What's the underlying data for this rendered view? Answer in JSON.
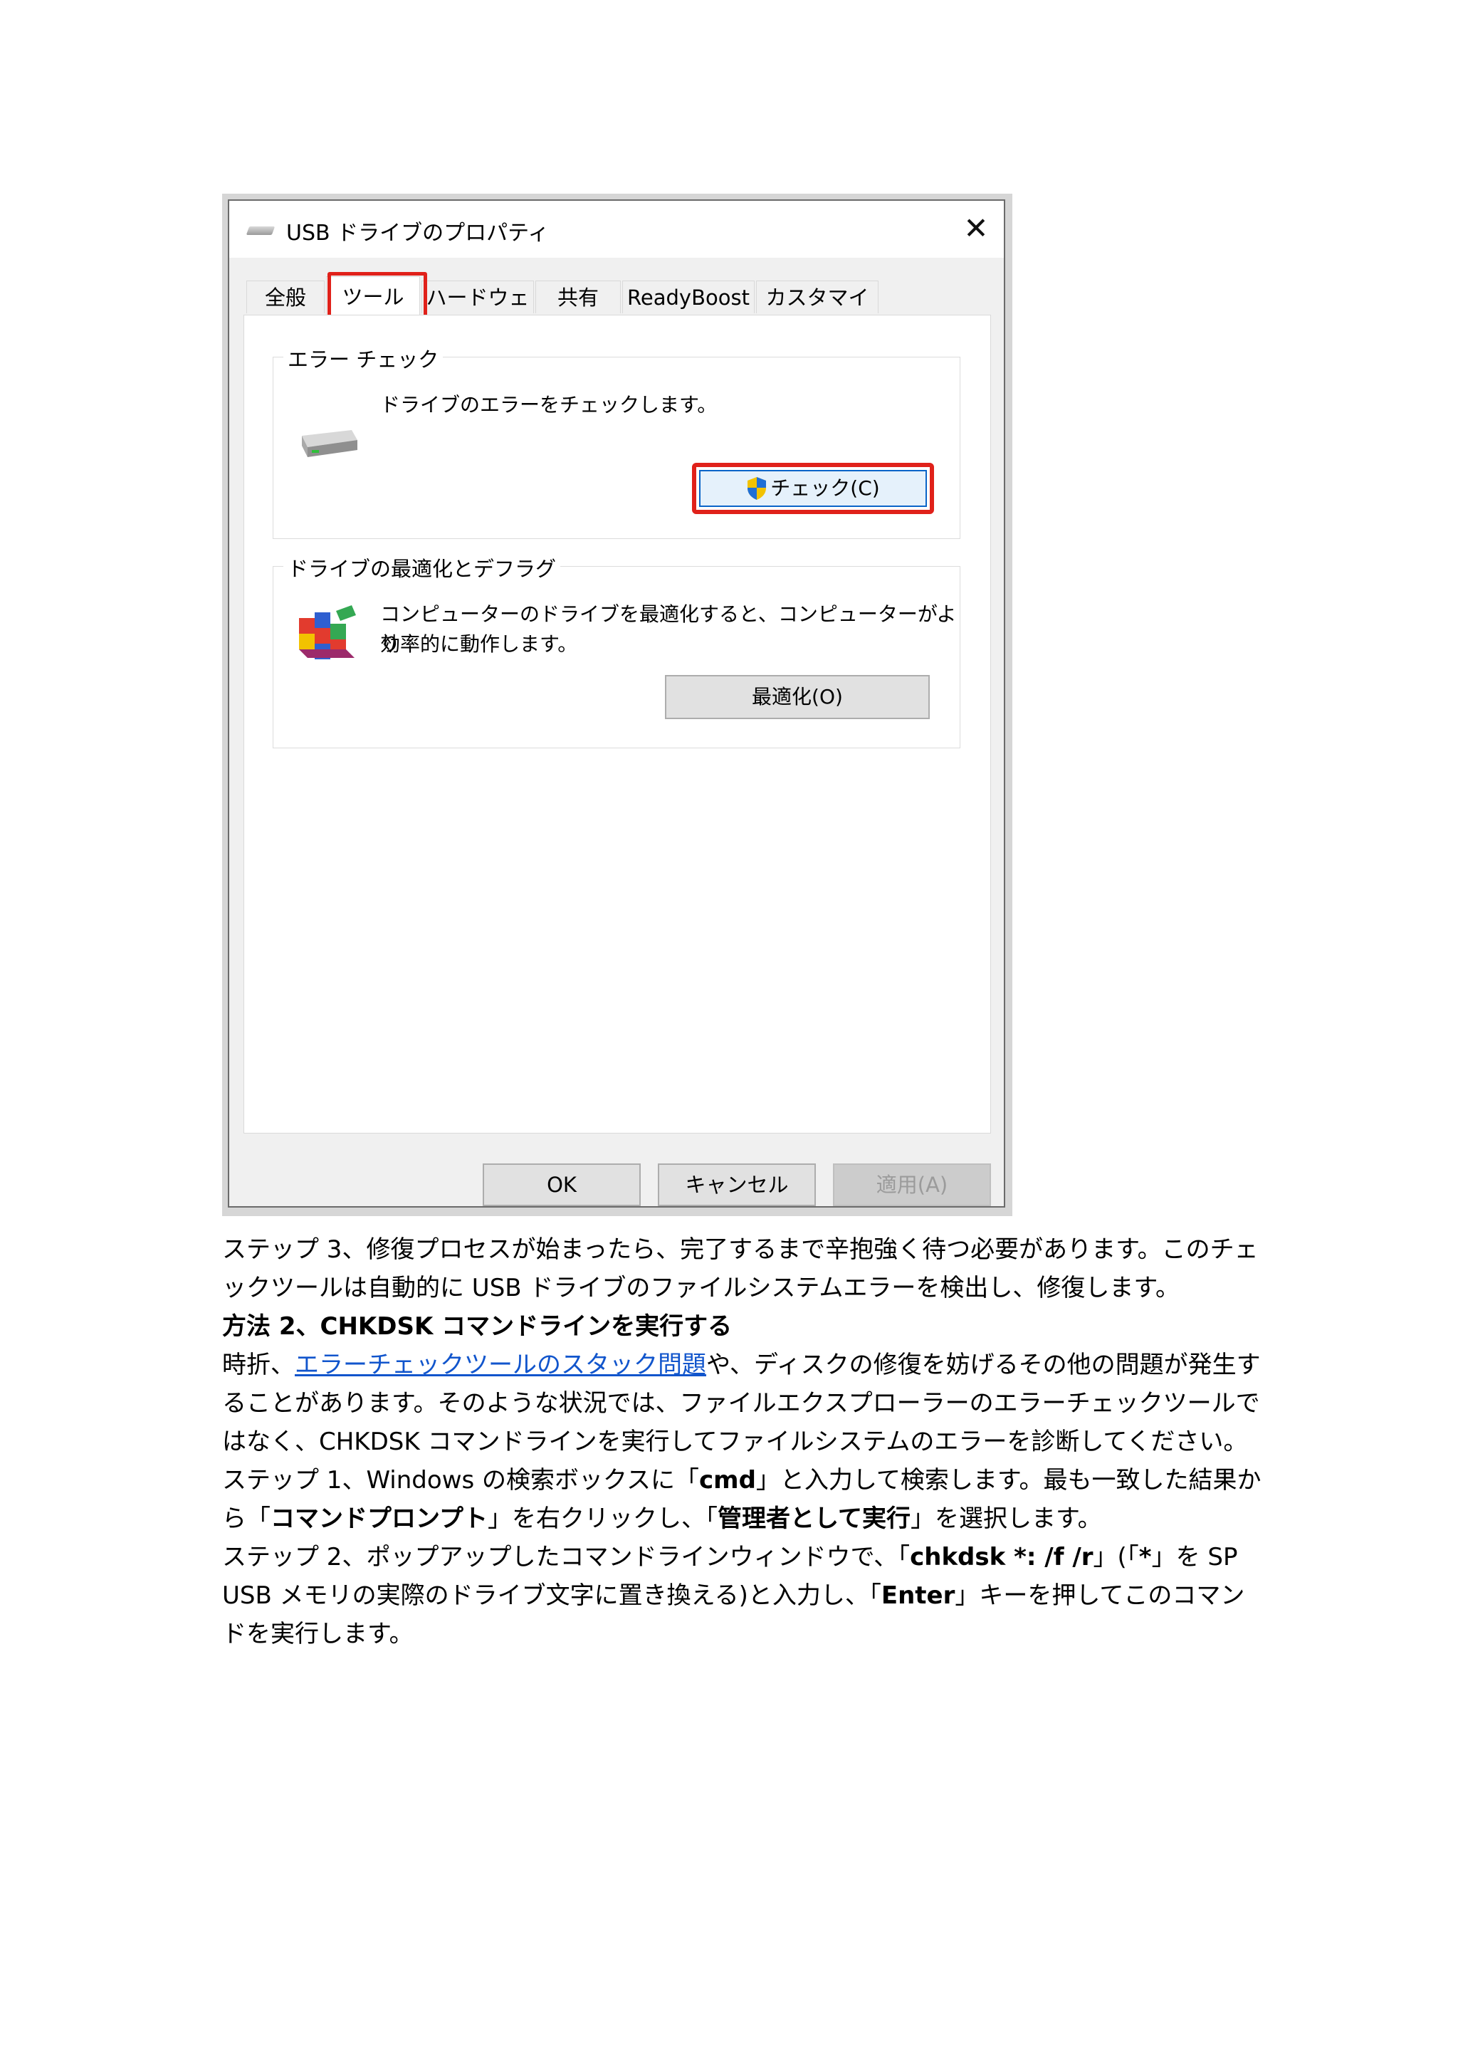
{
  "dialog": {
    "title": "USB ドライブのプロパティ",
    "close_glyph": "✕",
    "tabs": [
      "全般",
      "ツール",
      "ハードウェア",
      "共有",
      "ReadyBoost",
      "カスタマイズ"
    ],
    "active_tab": "ツール",
    "error_check": {
      "label": "エラー チェック",
      "description": "ドライブのエラーをチェックします。",
      "button": "チェック(C)"
    },
    "optimize": {
      "label": "ドライブの最適化とデフラグ",
      "description_line1": "コンピューターのドライブを最適化すると、コンピューターがより",
      "description_line2": "効率的に動作します。",
      "button": "最適化(O)"
    },
    "footer": {
      "ok": "OK",
      "cancel": "キャンセル",
      "apply": "適用(A)"
    },
    "highlight_color": "#e0211a"
  },
  "article": {
    "step3": "ステップ 3、修復プロセスが始まったら、完了するまで辛抱強く待つ必要があります。このチェックツールは自動的に USB ドライブのファイルシステムエラーを検出し、修復します。",
    "method2_heading": "方法 2、CHKDSK コマンドラインを実行する",
    "para_prefix": "時折、",
    "para_link": "エラーチェックツールのスタック問題",
    "para_suffix": "や、ディスクの修復を妨げるその他の問題が発生することがあります。そのような状況では、ファイルエクスプローラーのエラーチェックツールではなく、CHKDSK コマンドラインを実行してファイルシステムのエラーを診断してください。",
    "step1_a": "ステップ 1、Windows の検索ボックスに「",
    "step1_cmd": "cmd",
    "step1_b": "」と入力して検索します。最も一致した結果から「",
    "step1_prompt": "コマンドプロンプト",
    "step1_c": "」を右クリックし、「",
    "step1_admin": "管理者として実行",
    "step1_d": "」を選択します。",
    "step2_a": "ステップ 2、ポップアップしたコマンドラインウィンドウで、「",
    "step2_cmd": "chkdsk *: /f /r",
    "step2_b": "」(「",
    "step2_star": "*",
    "step2_c": "」を SP USB メモリの実際のドライブ文字に置き換える)と入力し、「",
    "step2_enter": "Enter",
    "step2_d": "」キーを押してこのコマンドを実行します。"
  }
}
